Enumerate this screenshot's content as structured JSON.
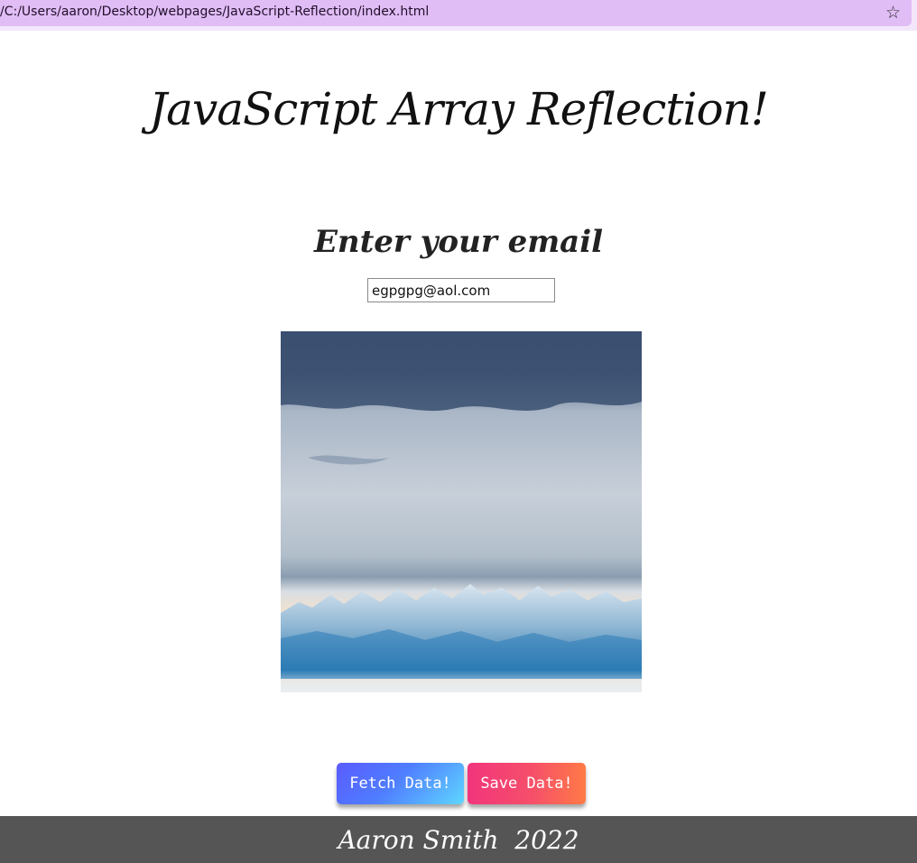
{
  "browser": {
    "url": "/C:/Users/aaron/Desktop/webpages/JavaScript-Reflection/index.html",
    "bookmark_icon": "star-icon"
  },
  "page": {
    "title": "JavaScript Array Reflection!",
    "email_heading": "Enter your email",
    "email_value": "egpgpg@aol.com"
  },
  "photo": {
    "subject": "snowy mountain range below a cloudy sky"
  },
  "buttons": {
    "fetch_label": "Fetch Data!",
    "save_label": "Save Data!"
  },
  "footer": {
    "credit": "Aaron Smith  2022"
  },
  "colors": {
    "addressbar": "#e1bdf6",
    "footer": "#555555",
    "fetch_gradient": [
      "#5a5cff",
      "#5fd6ff"
    ],
    "save_gradient": [
      "#f2357c",
      "#ff7a45"
    ]
  }
}
